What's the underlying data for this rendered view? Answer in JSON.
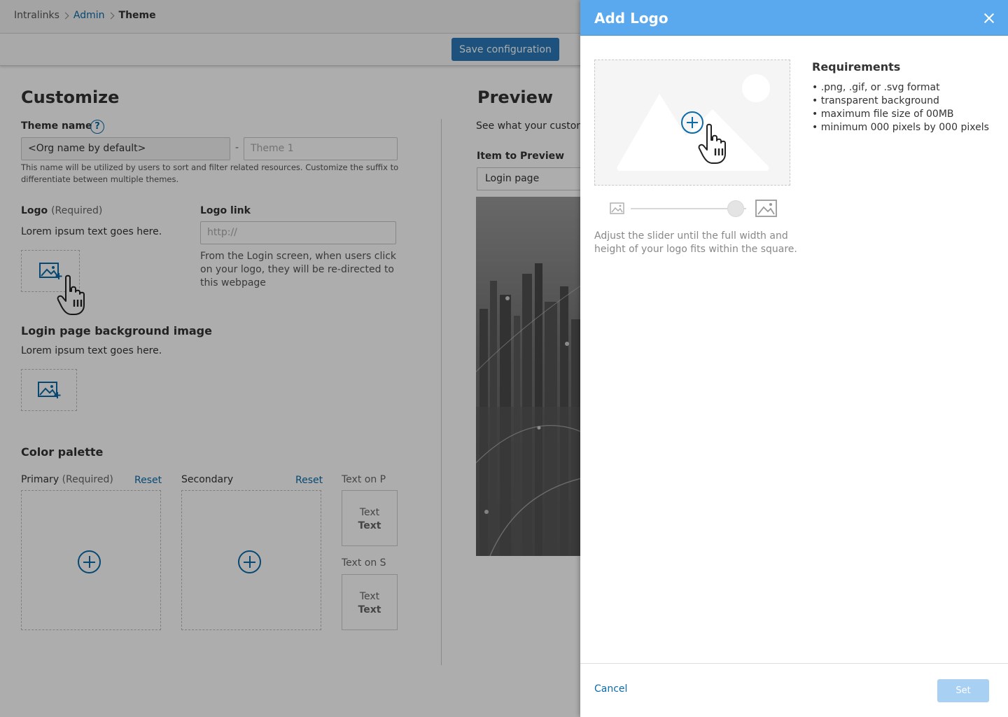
{
  "breadcrumb": {
    "items": [
      "Intralinks",
      "Admin",
      "Theme"
    ]
  },
  "toolbar": {
    "save_label": "Save configuration"
  },
  "customize": {
    "title": "Customize",
    "theme_name_label": "Theme name",
    "help_glyph": "?",
    "theme_name_value": "<Org name by default>",
    "dash": "-",
    "theme_suffix_placeholder": "Theme 1",
    "theme_help_line1": "This name will be utilized by users to sort and filter related resources. Customize the suffix to",
    "theme_help_line2": "differentiate between multiple themes.",
    "logo_label": "Logo",
    "required_text": "(Required)",
    "logo_desc": "Lorem ipsum text goes here.",
    "logo_link_label": "Logo link",
    "logo_link_placeholder": "http://",
    "logo_link_help_1": "From the Login screen, when users click",
    "logo_link_help_2": "on your logo, they will be re-directed to",
    "logo_link_help_3": "this webpage",
    "bg_label": "Login page background image",
    "bg_desc": "Lorem ipsum text goes here.",
    "palette_label": "Color palette",
    "primary_label": "Primary",
    "secondary_label": "Secondary",
    "reset_label": "Reset",
    "text_on_primary": "Text on P",
    "text_on_secondary": "Text on S",
    "text_sample": "Text"
  },
  "preview": {
    "title": "Preview",
    "desc": "See what your custom",
    "item_label": "Item to Preview",
    "item_value": "Login page"
  },
  "drawer": {
    "title": "Add Logo",
    "requirements_title": "Requirements",
    "requirements": [
      ".png, .gif, or .svg format",
      "transparent background",
      "maximum file size of 00MB",
      "minimum 000 pixels by 000 pixels"
    ],
    "adjust_line1": "Adjust the slider until the full width and",
    "adjust_line2": "height of your logo fits within the square.",
    "slider_value": 0.9,
    "cancel_label": "Cancel",
    "set_label": "Set"
  },
  "colors": {
    "accent": "#0b6aa8",
    "header": "#5aa8ee",
    "save_button": "#2a7ab8",
    "set_button_disabled": "#a8d0f2"
  },
  "icons": [
    "image-add-icon",
    "plus-circle-icon",
    "close-icon",
    "hand-cursor-icon",
    "image-small-icon",
    "image-large-icon"
  ]
}
